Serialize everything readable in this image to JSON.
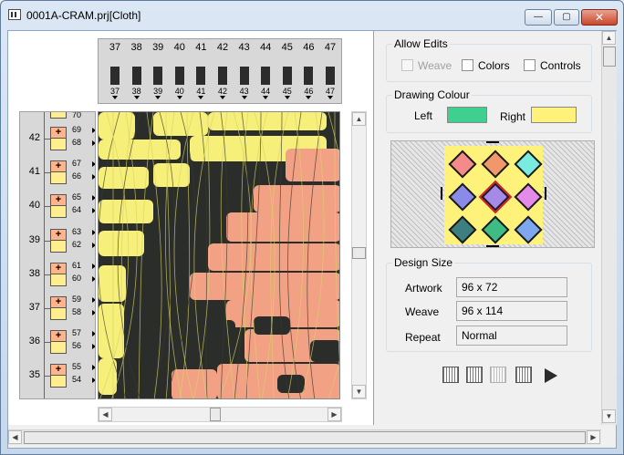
{
  "window": {
    "title": "0001A-CRAM.prj[Cloth]",
    "minimize_label": "—",
    "maximize_label": "▢",
    "close_label": "✕"
  },
  "shafts": {
    "numbers": [
      "37",
      "38",
      "39",
      "40",
      "41",
      "42",
      "43",
      "44",
      "45",
      "46",
      "47"
    ]
  },
  "treadles": {
    "top_partial_sub": "70",
    "rows": [
      {
        "num": "42",
        "sub1": "69",
        "sub2": "68"
      },
      {
        "num": "41",
        "sub1": "67",
        "sub2": "66"
      },
      {
        "num": "40",
        "sub1": "65",
        "sub2": "64"
      },
      {
        "num": "39",
        "sub1": "63",
        "sub2": "62"
      },
      {
        "num": "38",
        "sub1": "61",
        "sub2": "60"
      },
      {
        "num": "37",
        "sub1": "59",
        "sub2": "58"
      },
      {
        "num": "36",
        "sub1": "57",
        "sub2": "56"
      },
      {
        "num": "35",
        "sub1": "55",
        "sub2": "54"
      }
    ],
    "plus_label": "+"
  },
  "cloth": {
    "colors": {
      "background": "#2a2d2a",
      "yellow": "#f6ef7a",
      "salmon": "#f2a184",
      "thread_light": "#d8d36a",
      "thread_dark": "#3a3a2c"
    }
  },
  "allow_edits": {
    "title": "Allow Edits",
    "weave_label": "Weave",
    "colors_label": "Colors",
    "controls_label": "Controls",
    "weave_checked": false,
    "weave_enabled": false,
    "colors_checked": false,
    "controls_checked": false
  },
  "drawing_colour": {
    "title": "Drawing Colour",
    "left_label": "Left",
    "right_label": "Right",
    "left_color": "#3fcf8e",
    "right_color": "#fff27a"
  },
  "palette": {
    "background": "#fff27a",
    "dots": [
      "#f48a8a",
      "#f0986c",
      "#79ecdf",
      "#8a8ae8",
      "#a78ae8",
      "#e48ae8",
      "#3d7f7f",
      "#3ebc83",
      "#7fa7f0"
    ],
    "selected_index": 4
  },
  "design_size": {
    "title": "Design Size",
    "artwork_label": "Artwork",
    "artwork_value": "96 x 72",
    "weave_label": "Weave",
    "weave_value": "96 x 114",
    "repeat_label": "Repeat",
    "repeat_value": "Normal"
  },
  "toolbar": {
    "icons": [
      "loom-icon",
      "weave-draft-icon",
      "grid-icon",
      "print-preview-icon",
      "play-icon"
    ]
  }
}
